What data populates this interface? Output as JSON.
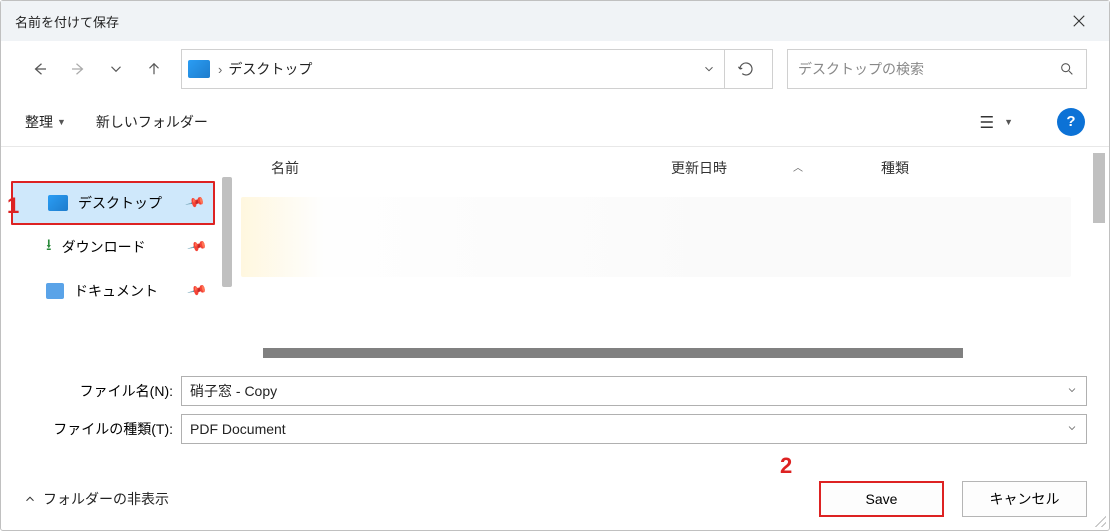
{
  "dialog": {
    "title": "名前を付けて保存"
  },
  "nav": {
    "location": "デスクトップ",
    "search_placeholder": "デスクトップの検索"
  },
  "toolbar": {
    "organize": "整理",
    "new_folder": "新しいフォルダー",
    "help_label": "?"
  },
  "sidebar": {
    "items": [
      {
        "label": "デスクトップ",
        "icon": "desktop",
        "selected": true,
        "pinned": true
      },
      {
        "label": "ダウンロード",
        "icon": "download",
        "selected": false,
        "pinned": true
      },
      {
        "label": "ドキュメント",
        "icon": "document",
        "selected": false,
        "pinned": true
      }
    ]
  },
  "columns": {
    "name": "名前",
    "date": "更新日時",
    "type": "種類"
  },
  "fields": {
    "filename_label": "ファイル名(N):",
    "filename_value": "硝子窓 - Copy",
    "filetype_label": "ファイルの種類(T):",
    "filetype_value": "PDF Document"
  },
  "bottom": {
    "hide_folders": "フォルダーの非表示",
    "save": "Save",
    "cancel": "キャンセル"
  },
  "annotations": {
    "n1": "1",
    "n2": "2"
  }
}
